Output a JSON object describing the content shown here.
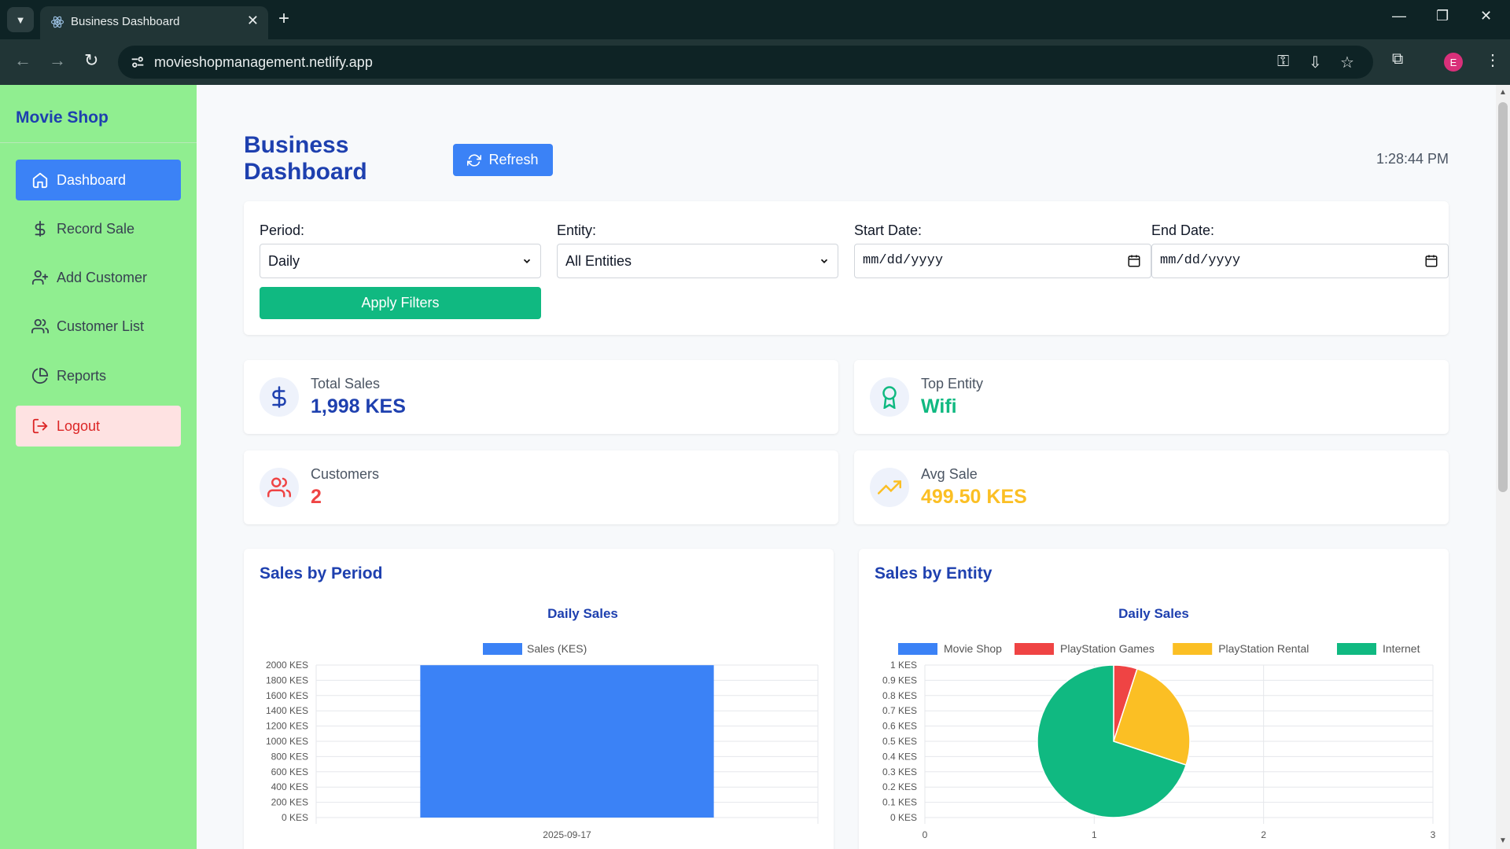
{
  "browser": {
    "tab_title": "Business Dashboard",
    "url": "movieshopmanagement.netlify.app",
    "profile_initial": "E"
  },
  "sidebar": {
    "brand": "Movie Shop",
    "items": [
      {
        "label": "Dashboard",
        "icon": "home-icon",
        "active": true
      },
      {
        "label": "Record Sale",
        "icon": "dollar-icon"
      },
      {
        "label": "Add Customer",
        "icon": "user-plus-icon"
      },
      {
        "label": "Customer List",
        "icon": "users-icon"
      },
      {
        "label": "Reports",
        "icon": "pie-chart-icon"
      },
      {
        "label": "Logout",
        "icon": "logout-icon"
      }
    ]
  },
  "header": {
    "title": "Business Dashboard",
    "refresh_label": "Refresh",
    "time": "1:28:44 PM"
  },
  "filters": {
    "period_label": "Period:",
    "period_value": "Daily",
    "entity_label": "Entity:",
    "entity_value": "All Entities",
    "start_label": "Start Date:",
    "start_placeholder": "mm/dd/yyyy",
    "end_label": "End Date:",
    "end_placeholder": "mm/dd/yyyy",
    "apply_label": "Apply Filters"
  },
  "stats": {
    "total_sales": {
      "label": "Total Sales",
      "value": "1,998 KES",
      "color": "#1e40af"
    },
    "top_entity": {
      "label": "Top Entity",
      "value": "Wifi",
      "color": "#10b981"
    },
    "customers": {
      "label": "Customers",
      "value": "2",
      "color": "#ef4444"
    },
    "avg_sale": {
      "label": "Avg Sale",
      "value": "499.50 KES",
      "color": "#fbbf24"
    }
  },
  "sales_by_period": {
    "heading": "Sales by Period",
    "chart_data": {
      "type": "bar",
      "title": "Daily Sales",
      "categories": [
        "2025-09-17"
      ],
      "series": [
        {
          "name": "Sales (KES)",
          "values": [
            1998
          ],
          "color": "#3b82f6"
        }
      ],
      "ylim": [
        0,
        2000
      ],
      "yticks": [
        "0 KES",
        "200 KES",
        "400 KES",
        "600 KES",
        "800 KES",
        "1000 KES",
        "1200 KES",
        "1400 KES",
        "1600 KES",
        "1800 KES",
        "2000 KES"
      ],
      "grid": true,
      "legend": "top"
    }
  },
  "sales_by_entity": {
    "heading": "Sales by Entity",
    "chart_data": {
      "type": "pie",
      "title": "Daily Sales",
      "legend": [
        {
          "name": "Movie Shop",
          "color": "#3b82f6"
        },
        {
          "name": "PlayStation Games",
          "color": "#ef4444"
        },
        {
          "name": "PlayStation Rental",
          "color": "#fbbf24"
        },
        {
          "name": "Internet",
          "color": "#10b981"
        }
      ],
      "slices": [
        {
          "name": "Movie Shop",
          "value": 0,
          "color": "#3b82f6"
        },
        {
          "name": "PlayStation Games",
          "value": 100,
          "color": "#ef4444"
        },
        {
          "name": "PlayStation Rental",
          "value": 500,
          "color": "#fbbf24"
        },
        {
          "name": "Internet",
          "value": 1398,
          "color": "#10b981"
        }
      ],
      "yticks": [
        "0 KES",
        "0.1 KES",
        "0.2 KES",
        "0.3 KES",
        "0.4 KES",
        "0.5 KES",
        "0.6 KES",
        "0.7 KES",
        "0.8 KES",
        "0.9 KES",
        "1 KES"
      ],
      "xticks": [
        "0",
        "1",
        "2",
        "3"
      ],
      "grid": true,
      "legend_position": "top"
    }
  }
}
